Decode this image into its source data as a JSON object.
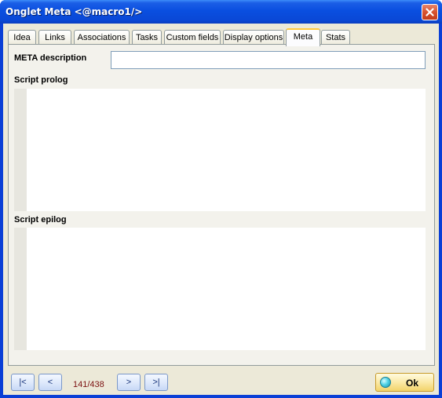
{
  "window": {
    "title": "Onglet Meta <@macro1/>"
  },
  "tabs": [
    {
      "label": "Idea"
    },
    {
      "label": "Links"
    },
    {
      "label": "Associations"
    },
    {
      "label": "Tasks"
    },
    {
      "label": "Custom fields"
    },
    {
      "label": "Display options"
    },
    {
      "label": "Meta"
    },
    {
      "label": "Stats"
    }
  ],
  "active_tab": "Meta",
  "form": {
    "meta_description_label": "META description",
    "meta_description_value": "",
    "script_prolog_label": "Script prolog",
    "script_prolog_value": "",
    "script_epilog_label": "Script epilog",
    "script_epilog_value": ""
  },
  "footer": {
    "first_label": "|<",
    "prev_label": "<",
    "counter": "141/438",
    "next_label": ">",
    "last_label": ">|",
    "ok_label": "Ok"
  },
  "icons": {
    "close": "close-icon",
    "ok": "green-dot-icon"
  }
}
